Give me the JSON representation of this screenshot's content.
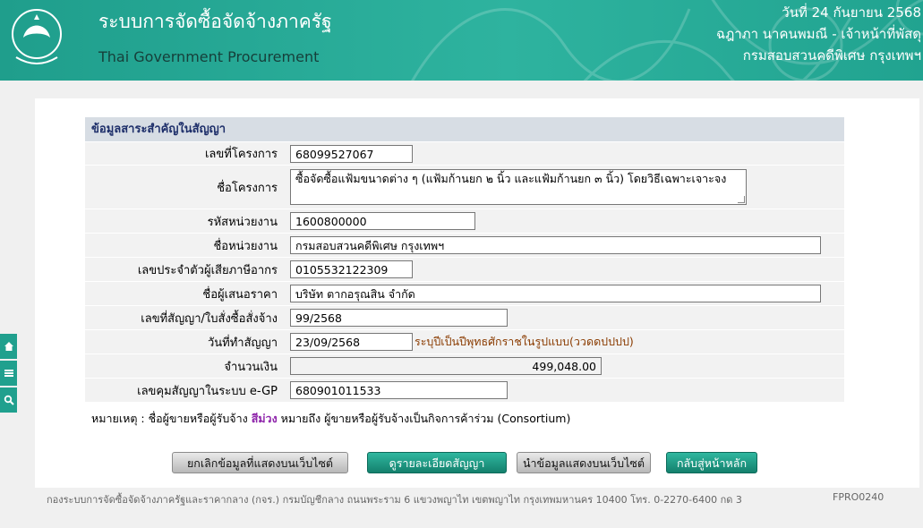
{
  "header": {
    "title_th": "ระบบการจัดซื้อจัดจ้างภาครัฐ",
    "title_en": "Thai Government Procurement",
    "date": "วันที่ 24 กันยายน 2568",
    "user": "ฉฎาภา นาคนพมณี - เจ้าหน้าที่พัสดุ",
    "department": "กรมสอบสวนคดีพิเศษ กรุงเทพฯ",
    "logo_icon": "comptroller-general-emblem-icon"
  },
  "side_tools": [
    "home-icon",
    "menu-icon",
    "search-icon"
  ],
  "section_title": "ข้อมูลสาระสำคัญในสัญญา",
  "fields": {
    "project_no": {
      "label": "เลขที่โครงการ",
      "value": "68099527067"
    },
    "project_name": {
      "label": "ชื่อโครงการ",
      "value": "ซื้อจัดซื้อแฟ้มขนาดต่าง ๆ (แฟ้มก้านยก ๒ นิ้ว และแฟ้มก้านยก ๓ นิ้ว) โดยวิธีเฉพาะเจาะจง"
    },
    "agency_code": {
      "label": "รหัสหน่วยงาน",
      "value": "1600800000"
    },
    "agency_name": {
      "label": "ชื่อหน่วยงาน",
      "value": "กรมสอบสวนคดีพิเศษ กรุงเทพฯ"
    },
    "tax_id": {
      "label": "เลขประจำตัวผู้เสียภาษีอากร",
      "value": "0105532122309"
    },
    "bidder": {
      "label": "ชื่อผู้เสนอราคา",
      "value": "บริษัท ตากอรุณสิน จำกัด"
    },
    "contract_no": {
      "label": "เลขที่สัญญา/ใบสั่งซื้อสั่งจ้าง",
      "value": "99/2568"
    },
    "contract_date": {
      "label": "วันที่ทำสัญญา",
      "value": "23/09/2568",
      "hint": "ระบุปีเป็นปีพุทธศักราชในรูปแบบ(ววดดปปปป)"
    },
    "amount": {
      "label": "จำนวนเงิน",
      "value": "499,048.00"
    },
    "egp_no": {
      "label": "เลขคุมสัญญาในระบบ e-GP",
      "value": "680901011533"
    }
  },
  "note": {
    "prefix": "หมายเหตุ : ชื่อผู้ขายหรือผู้รับจ้าง",
    "highlight": "สีม่วง",
    "suffix": "หมายถึง ผู้ขายหรือผู้รับจ้างเป็นกิจการค้าร่วม (Consortium)",
    "highlight_color": "#8e24aa"
  },
  "buttons": {
    "cancel_publish": "ยกเลิกข้อมูลที่แสดงบนเว็บไซต์",
    "view_contract": "ดูรายละเอียดสัญญา",
    "publish": "นำข้อมูลแสดงบนเว็บไซต์",
    "back_home": "กลับสู่หน้าหลัก"
  },
  "footer": {
    "address": "กองระบบการจัดซื้อจัดจ้างภาครัฐและราคากลาง (กจร.) กรมบัญชีกลาง ถนนพระราม 6 แขวงพญาไท เขตพญาไท กรุงเทพมหานคร 10400 โทร. 0-2270-6400 กด 3",
    "code": "FPRO0240"
  },
  "colors": {
    "brand": "#21a390",
    "button_green": "#14806d",
    "hint": "#8a3b00"
  }
}
